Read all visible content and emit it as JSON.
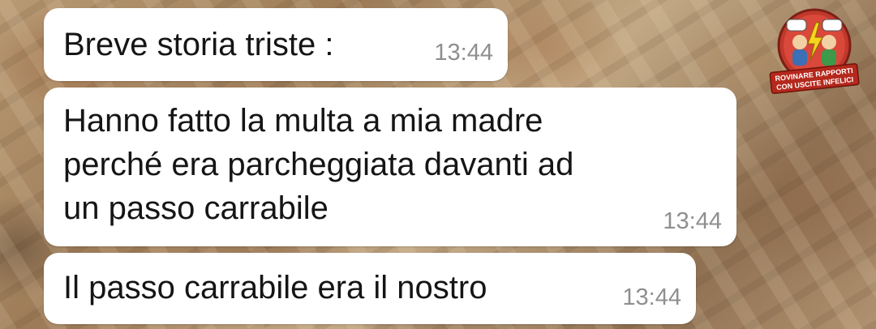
{
  "messages": [
    {
      "text": "Breve storia triste :",
      "time": "13:44"
    },
    {
      "text": "Hanno fatto la multa a mia madre\nperché era parcheggiata davanti ad\nun passo carrabile",
      "time": "13:44"
    },
    {
      "text": "Il passo carrabile era il nostro",
      "time": "13:44"
    }
  ],
  "watermark": {
    "line1": "ROVINARE RAPPORTI",
    "line2": "CON USCITE INFELICI"
  },
  "colors": {
    "bubble": "#ffffff",
    "text": "#151515",
    "timestamp": "#8f8f8f",
    "logo_red": "#c0392b"
  }
}
